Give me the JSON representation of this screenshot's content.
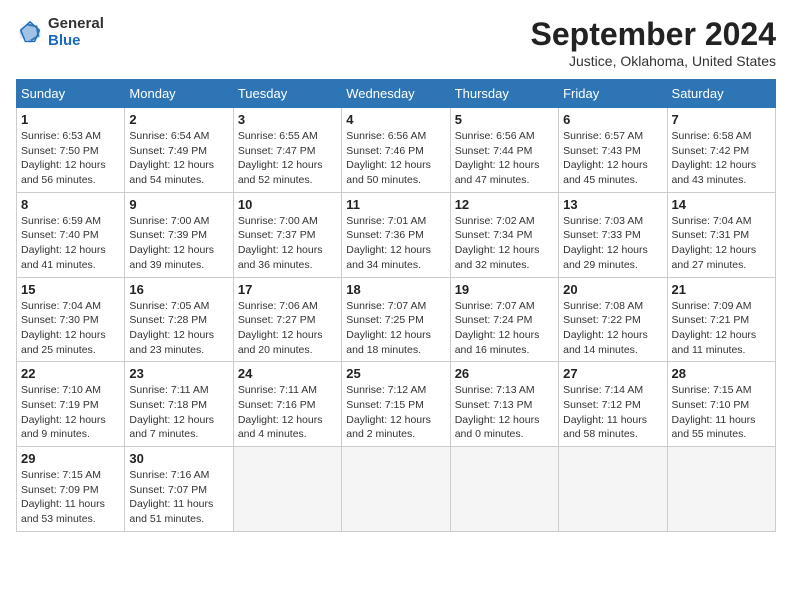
{
  "header": {
    "logo_general": "General",
    "logo_blue": "Blue",
    "title": "September 2024",
    "location": "Justice, Oklahoma, United States"
  },
  "weekdays": [
    "Sunday",
    "Monday",
    "Tuesday",
    "Wednesday",
    "Thursday",
    "Friday",
    "Saturday"
  ],
  "weeks": [
    [
      {
        "day": "1",
        "sunrise": "6:53 AM",
        "sunset": "7:50 PM",
        "daylight": "12 hours and 56 minutes."
      },
      {
        "day": "2",
        "sunrise": "6:54 AM",
        "sunset": "7:49 PM",
        "daylight": "12 hours and 54 minutes."
      },
      {
        "day": "3",
        "sunrise": "6:55 AM",
        "sunset": "7:47 PM",
        "daylight": "12 hours and 52 minutes."
      },
      {
        "day": "4",
        "sunrise": "6:56 AM",
        "sunset": "7:46 PM",
        "daylight": "12 hours and 50 minutes."
      },
      {
        "day": "5",
        "sunrise": "6:56 AM",
        "sunset": "7:44 PM",
        "daylight": "12 hours and 47 minutes."
      },
      {
        "day": "6",
        "sunrise": "6:57 AM",
        "sunset": "7:43 PM",
        "daylight": "12 hours and 45 minutes."
      },
      {
        "day": "7",
        "sunrise": "6:58 AM",
        "sunset": "7:42 PM",
        "daylight": "12 hours and 43 minutes."
      }
    ],
    [
      {
        "day": "8",
        "sunrise": "6:59 AM",
        "sunset": "7:40 PM",
        "daylight": "12 hours and 41 minutes."
      },
      {
        "day": "9",
        "sunrise": "7:00 AM",
        "sunset": "7:39 PM",
        "daylight": "12 hours and 39 minutes."
      },
      {
        "day": "10",
        "sunrise": "7:00 AM",
        "sunset": "7:37 PM",
        "daylight": "12 hours and 36 minutes."
      },
      {
        "day": "11",
        "sunrise": "7:01 AM",
        "sunset": "7:36 PM",
        "daylight": "12 hours and 34 minutes."
      },
      {
        "day": "12",
        "sunrise": "7:02 AM",
        "sunset": "7:34 PM",
        "daylight": "12 hours and 32 minutes."
      },
      {
        "day": "13",
        "sunrise": "7:03 AM",
        "sunset": "7:33 PM",
        "daylight": "12 hours and 29 minutes."
      },
      {
        "day": "14",
        "sunrise": "7:04 AM",
        "sunset": "7:31 PM",
        "daylight": "12 hours and 27 minutes."
      }
    ],
    [
      {
        "day": "15",
        "sunrise": "7:04 AM",
        "sunset": "7:30 PM",
        "daylight": "12 hours and 25 minutes."
      },
      {
        "day": "16",
        "sunrise": "7:05 AM",
        "sunset": "7:28 PM",
        "daylight": "12 hours and 23 minutes."
      },
      {
        "day": "17",
        "sunrise": "7:06 AM",
        "sunset": "7:27 PM",
        "daylight": "12 hours and 20 minutes."
      },
      {
        "day": "18",
        "sunrise": "7:07 AM",
        "sunset": "7:25 PM",
        "daylight": "12 hours and 18 minutes."
      },
      {
        "day": "19",
        "sunrise": "7:07 AM",
        "sunset": "7:24 PM",
        "daylight": "12 hours and 16 minutes."
      },
      {
        "day": "20",
        "sunrise": "7:08 AM",
        "sunset": "7:22 PM",
        "daylight": "12 hours and 14 minutes."
      },
      {
        "day": "21",
        "sunrise": "7:09 AM",
        "sunset": "7:21 PM",
        "daylight": "12 hours and 11 minutes."
      }
    ],
    [
      {
        "day": "22",
        "sunrise": "7:10 AM",
        "sunset": "7:19 PM",
        "daylight": "12 hours and 9 minutes."
      },
      {
        "day": "23",
        "sunrise": "7:11 AM",
        "sunset": "7:18 PM",
        "daylight": "12 hours and 7 minutes."
      },
      {
        "day": "24",
        "sunrise": "7:11 AM",
        "sunset": "7:16 PM",
        "daylight": "12 hours and 4 minutes."
      },
      {
        "day": "25",
        "sunrise": "7:12 AM",
        "sunset": "7:15 PM",
        "daylight": "12 hours and 2 minutes."
      },
      {
        "day": "26",
        "sunrise": "7:13 AM",
        "sunset": "7:13 PM",
        "daylight": "12 hours and 0 minutes."
      },
      {
        "day": "27",
        "sunrise": "7:14 AM",
        "sunset": "7:12 PM",
        "daylight": "11 hours and 58 minutes."
      },
      {
        "day": "28",
        "sunrise": "7:15 AM",
        "sunset": "7:10 PM",
        "daylight": "11 hours and 55 minutes."
      }
    ],
    [
      {
        "day": "29",
        "sunrise": "7:15 AM",
        "sunset": "7:09 PM",
        "daylight": "11 hours and 53 minutes."
      },
      {
        "day": "30",
        "sunrise": "7:16 AM",
        "sunset": "7:07 PM",
        "daylight": "11 hours and 51 minutes."
      },
      null,
      null,
      null,
      null,
      null
    ]
  ],
  "labels": {
    "sunrise_prefix": "Sunrise: ",
    "sunset_prefix": "Sunset: ",
    "daylight_prefix": "Daylight: "
  }
}
